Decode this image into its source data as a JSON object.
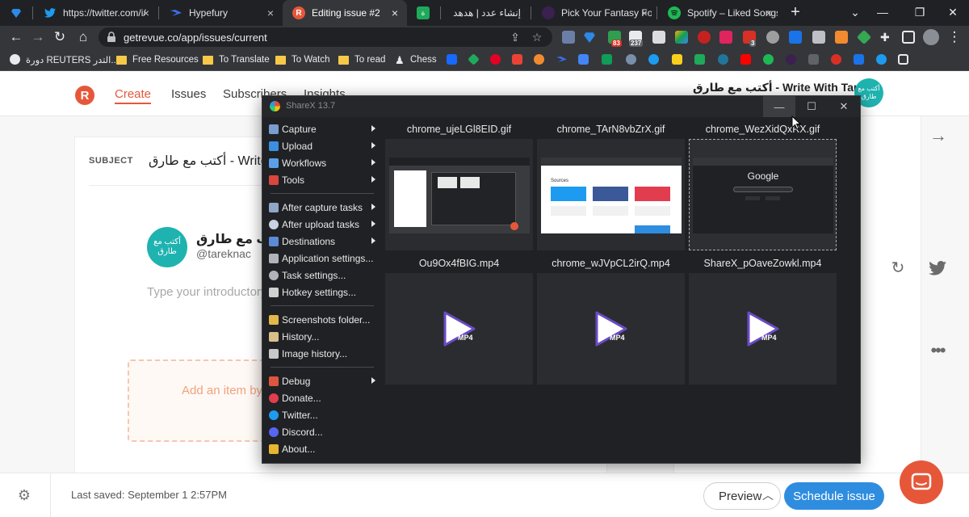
{
  "browser": {
    "tabs": [
      {
        "label": "",
        "favicon_color": "#1e6fd9",
        "favicon": "diamond"
      },
      {
        "label": "https://twitter.com/i/",
        "favicon_color": "#1d9bf0",
        "favicon": "twitter"
      },
      {
        "label": "Hypefury",
        "favicon_color": "#3a6df0",
        "favicon": "hypefury"
      },
      {
        "label": "Editing issue #2",
        "favicon_color": "#e6573a",
        "favicon": "R",
        "active": true
      },
      {
        "label": "",
        "favicon_color": "#1eaa5a",
        "favicon": "green-square"
      },
      {
        "label": "إنشاء عدد | هدهد",
        "favicon_color": "#2b2b2b",
        "favicon": "blank"
      },
      {
        "label": "Pick Your Fantasy Fo",
        "favicon_color": "#7a3aa6",
        "favicon": "fantasy"
      },
      {
        "label": "Spotify – Liked Songs",
        "favicon_color": "#1db954",
        "favicon": "spotify"
      }
    ],
    "url": "getrevue.co/app/issues/current",
    "extension_badges": [
      "83",
      "237",
      "3"
    ],
    "bookmarks": [
      {
        "label": "دورة REUTERS التدر...",
        "type": "site"
      },
      {
        "label": "Free Resources",
        "type": "folder"
      },
      {
        "label": "To Translate",
        "type": "folder"
      },
      {
        "label": "To Watch",
        "type": "folder"
      },
      {
        "label": "To read",
        "type": "folder"
      },
      {
        "label": "Chess",
        "type": "site"
      }
    ]
  },
  "revue": {
    "logo_letter": "R",
    "nav": [
      "Create",
      "Issues",
      "Subscribers",
      "Insights"
    ],
    "brand_title": "أكتب مع طارق - Write With Tarek",
    "brand_avatar_text": "أكتب مع طارق",
    "subject_label": "SUBJECT",
    "subject_value": "أكتب مع طارق - Write W",
    "author_name": "أكتب مع طارق",
    "author_handle": "@tareknac",
    "intro_placeholder": "Type your introductory",
    "add_item_label": "Add an item by",
    "last_saved": "Last saved: September 1 2:57PM",
    "preview_label": "Preview",
    "schedule_label": "Schedule issue",
    "accent": "#e6573a",
    "primary": "#2f8ddf",
    "teal": "#1fb3b0"
  },
  "sharex": {
    "title": "ShareX 13.7",
    "menu": [
      {
        "label": "Capture",
        "submenu": true,
        "icon_color": "#7a9ccf"
      },
      {
        "label": "Upload",
        "submenu": true,
        "icon_color": "#3a8fe0"
      },
      {
        "label": "Workflows",
        "submenu": true,
        "icon_color": "#5aa0e8"
      },
      {
        "label": "Tools",
        "submenu": true,
        "icon_color": "#d9463e"
      },
      {
        "label": "After capture tasks",
        "submenu": true,
        "icon_color": "#8fa6c8"
      },
      {
        "label": "After upload tasks",
        "submenu": true,
        "icon_color": "#c8d2e0"
      },
      {
        "label": "Destinations",
        "submenu": true,
        "icon_color": "#5b8ad6"
      },
      {
        "label": "Application settings...",
        "submenu": false,
        "icon_color": "#b0b4ba"
      },
      {
        "label": "Task settings...",
        "submenu": false,
        "icon_color": "#b0b4ba"
      },
      {
        "label": "Hotkey settings...",
        "submenu": false,
        "icon_color": "#d0d0d0"
      },
      {
        "label": "Screenshots folder...",
        "submenu": false,
        "icon_color": "#e3b74a"
      },
      {
        "label": "History...",
        "submenu": false,
        "icon_color": "#d8c08a"
      },
      {
        "label": "Image history...",
        "submenu": false,
        "icon_color": "#c8c8c8"
      },
      {
        "label": "Debug",
        "submenu": true,
        "icon_color": "#e0553f"
      },
      {
        "label": "Donate...",
        "submenu": false,
        "icon_color": "#e23d4f"
      },
      {
        "label": "Twitter...",
        "submenu": false,
        "icon_color": "#1d9bf0"
      },
      {
        "label": "Discord...",
        "submenu": false,
        "icon_color": "#5865f2"
      },
      {
        "label": "About...",
        "submenu": false,
        "icon_color": "#e8b530"
      }
    ],
    "files": [
      {
        "name": "chrome_ujeLGl8EID.gif",
        "kind": "gif",
        "preview": "sharex-screenshot"
      },
      {
        "name": "chrome_TArN8vbZrX.gif",
        "kind": "gif",
        "preview": "sources-page"
      },
      {
        "name": "chrome_WezXidQxRX.gif",
        "kind": "gif",
        "preview": "google",
        "preview_text": "Google",
        "selected": true
      },
      {
        "name": "Ou9Ox4fBIG.mp4",
        "kind": "mp4",
        "badge": "MP4"
      },
      {
        "name": "chrome_wJVpCL2irQ.mp4",
        "kind": "mp4",
        "badge": "MP4"
      },
      {
        "name": "ShareX_pOaveZowkl.mp4",
        "kind": "mp4",
        "badge": "MP4"
      }
    ],
    "sources_title": "Sources"
  }
}
